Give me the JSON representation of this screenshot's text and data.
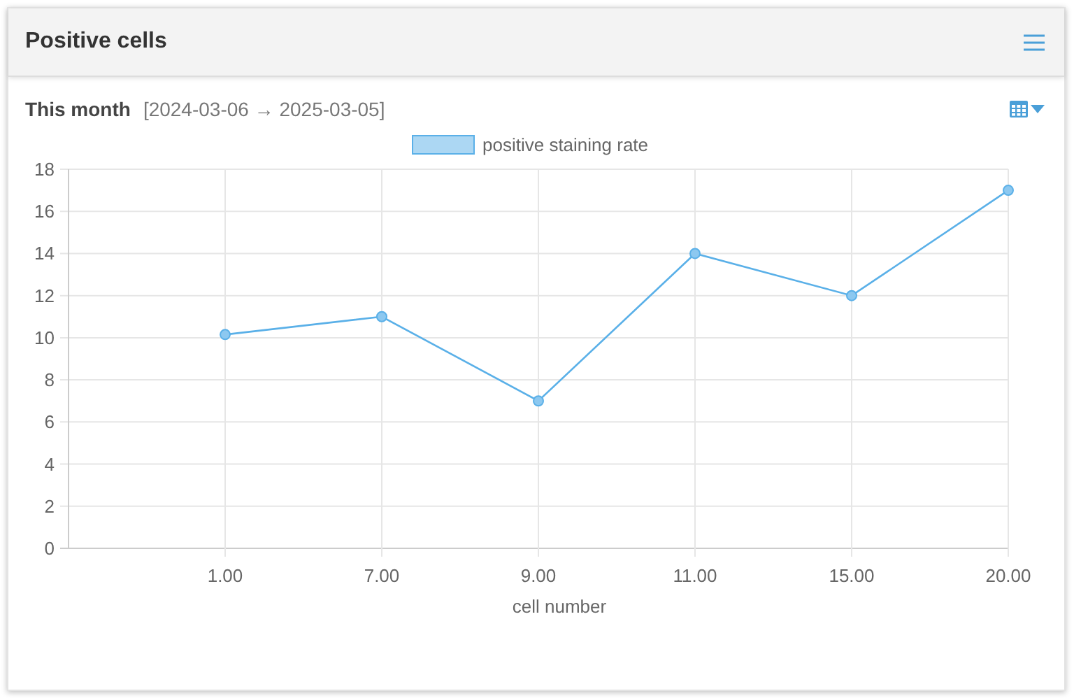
{
  "panel": {
    "title": "Positive cells"
  },
  "period": {
    "label": "This month",
    "range": "[2024-03-06 → 2025-03-05]"
  },
  "chart_data": {
    "type": "line",
    "xlabel": "cell number",
    "categories": [
      "1.00",
      "7.00",
      "9.00",
      "11.00",
      "15.00",
      "20.00"
    ],
    "grid": true,
    "series": [
      {
        "name": "positive staining rate",
        "color": "#5ab0e8",
        "marker": "circle",
        "values": [
          10.15,
          11,
          7,
          14,
          12,
          17
        ]
      }
    ],
    "ylim": [
      0,
      18
    ],
    "yticks": [
      0,
      2,
      4,
      6,
      8,
      10,
      12,
      14,
      16,
      18
    ]
  }
}
